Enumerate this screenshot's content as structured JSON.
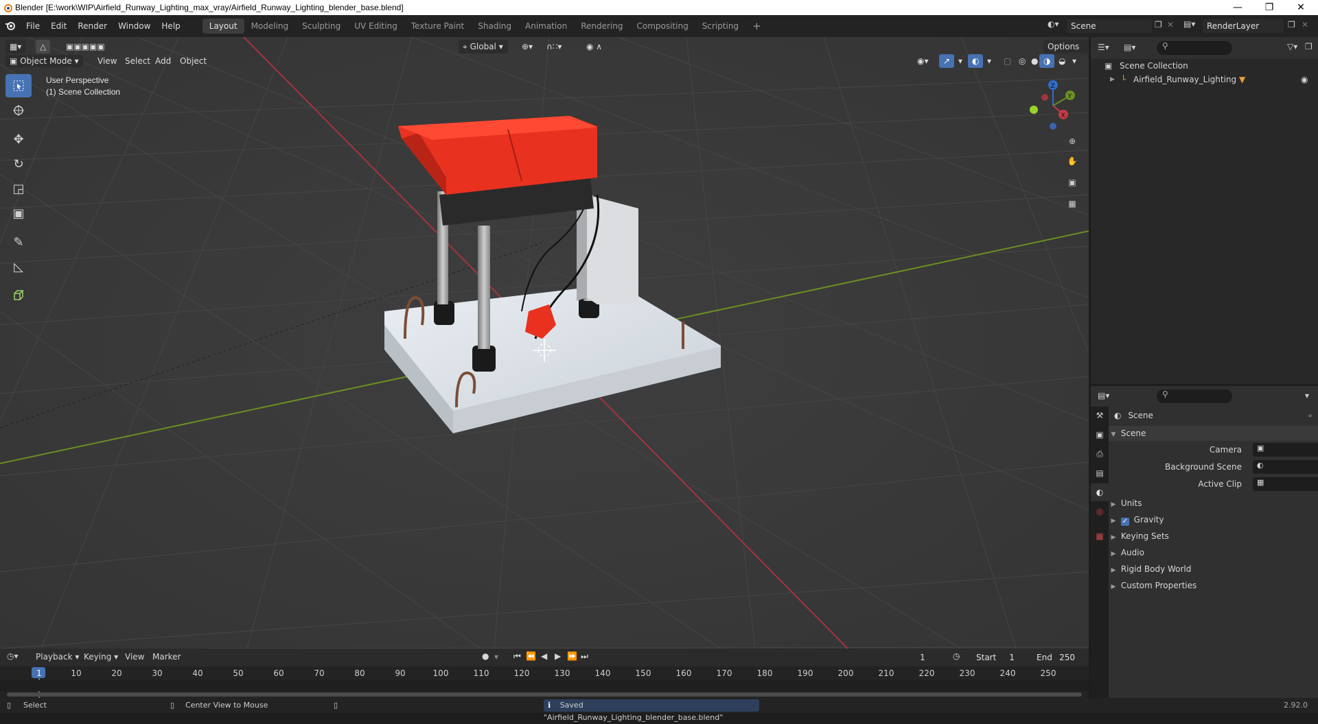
{
  "window": {
    "title": "Blender [E:\\work\\WIP\\Airfield_Runway_Lighting_max_vray/Airfield_Runway_Lighting_blender_base.blend]"
  },
  "menu": [
    "File",
    "Edit",
    "Render",
    "Window",
    "Help"
  ],
  "workspaces": [
    "Layout",
    "Modeling",
    "Sculpting",
    "UV Editing",
    "Texture Paint",
    "Shading",
    "Animation",
    "Rendering",
    "Compositing",
    "Scripting"
  ],
  "active_workspace": "Layout",
  "scene_field": "Scene",
  "view_layer_field": "RenderLayer",
  "viewport": {
    "mode": "Object Mode",
    "menus": [
      "View",
      "Select",
      "Add",
      "Object"
    ],
    "transform_orientation": "Global",
    "options_label": "Options",
    "overlay_line1": "User Perspective",
    "overlay_line2": "(1) Scene Collection",
    "gizmo": {
      "x": "X",
      "y": "Y",
      "z": "Z"
    }
  },
  "outliner": {
    "root": "Scene Collection",
    "items": [
      {
        "label": "Airfield_Runway_Lighting"
      }
    ]
  },
  "properties": {
    "context_title": "Scene",
    "panel_title": "Scene",
    "fields": [
      {
        "label": "Camera"
      },
      {
        "label": "Background Scene"
      },
      {
        "label": "Active Clip"
      }
    ],
    "sections": [
      "Units",
      "Gravity",
      "Keying Sets",
      "Audio",
      "Rigid Body World",
      "Custom Properties"
    ],
    "gravity_checked": true
  },
  "timeline": {
    "menus": [
      "Playback",
      "Keying",
      "View",
      "Marker"
    ],
    "current_frame": "1",
    "start_label": "Start",
    "start_value": "1",
    "end_label": "End",
    "end_value": "250",
    "ruler": [
      "1",
      "10",
      "20",
      "30",
      "40",
      "50",
      "60",
      "70",
      "80",
      "90",
      "100",
      "110",
      "120",
      "130",
      "140",
      "150",
      "160",
      "170",
      "180",
      "190",
      "200",
      "210",
      "220",
      "230",
      "240",
      "250"
    ]
  },
  "statusbar": {
    "left1": "Select",
    "left2": "Center View to Mouse",
    "message": "Saved \"Airfield_Runway_Lighting_blender_base.blend\"",
    "version": "2.92.0"
  },
  "colors": {
    "accent": "#4772b3",
    "x_axis": "#a4343f",
    "y_axis": "#6b8f23",
    "red_body": "#e8311f"
  }
}
